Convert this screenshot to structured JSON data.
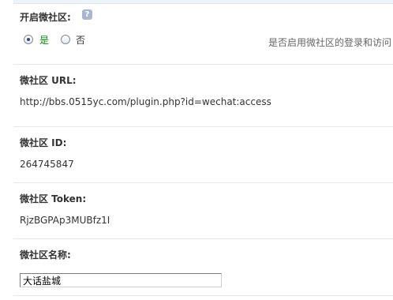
{
  "enable_section": {
    "label": "开启微社区:",
    "help_icon": "?",
    "options": [
      {
        "label": "是",
        "selected": true,
        "color": "#0a8a0a"
      },
      {
        "label": "否",
        "selected": false,
        "color": "#333333"
      }
    ],
    "hint": "是否启用微社区的登录和访问"
  },
  "url_section": {
    "label": "微社区 URL:",
    "value": "http://bbs.0515yc.com/plugin.php?id=wechat:access"
  },
  "id_section": {
    "label": "微社区 ID:",
    "value": "264745847"
  },
  "token_section": {
    "label": "微社区 Token:",
    "value": "RjzBGPAp3MUBfz1I"
  },
  "name_section": {
    "label": "微社区名称:",
    "input_value": "大话盐城"
  }
}
